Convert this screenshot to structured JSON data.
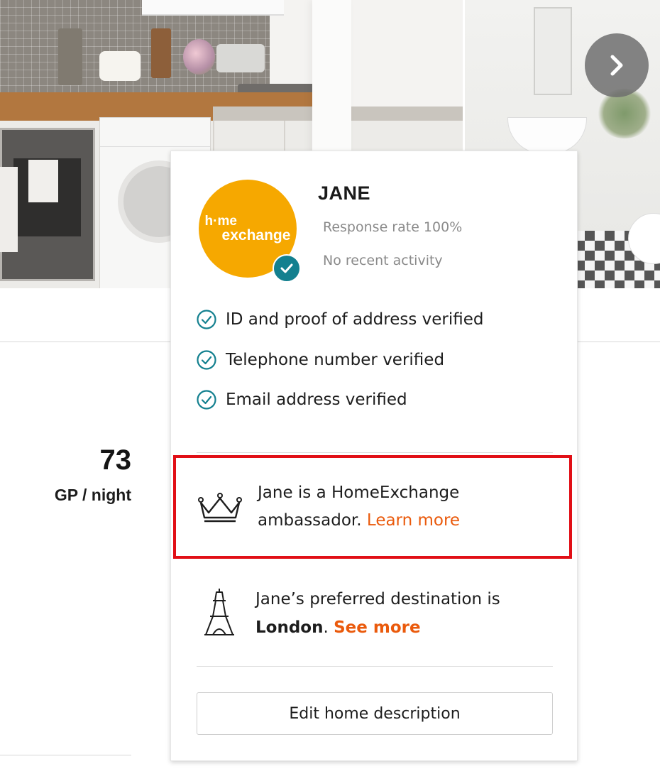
{
  "gallery": {
    "next_icon": "chevron-right-icon"
  },
  "listing": {
    "price_value": "73",
    "price_unit": "GP / night"
  },
  "host_card": {
    "avatar_logo": {
      "line1": "h·me",
      "line2": "exchange"
    },
    "name": "JANE",
    "response_rate": "Response rate 100%",
    "activity": "No recent activity",
    "verifications": [
      "ID and proof of address verified",
      "Telephone number verified",
      "Email address verified"
    ],
    "ambassador": {
      "text": "Jane is a HomeExchange ambassador. ",
      "link": "Learn more"
    },
    "destination": {
      "prefix": "Jane’s preferred destination is ",
      "city": "London",
      "suffix": ". ",
      "link": "See more"
    },
    "edit_button": "Edit home description"
  },
  "colors": {
    "brand_orange": "#f6a800",
    "link_orange": "#ea5a0c",
    "verified_teal": "#13808f",
    "highlight_red": "#e10f16"
  }
}
